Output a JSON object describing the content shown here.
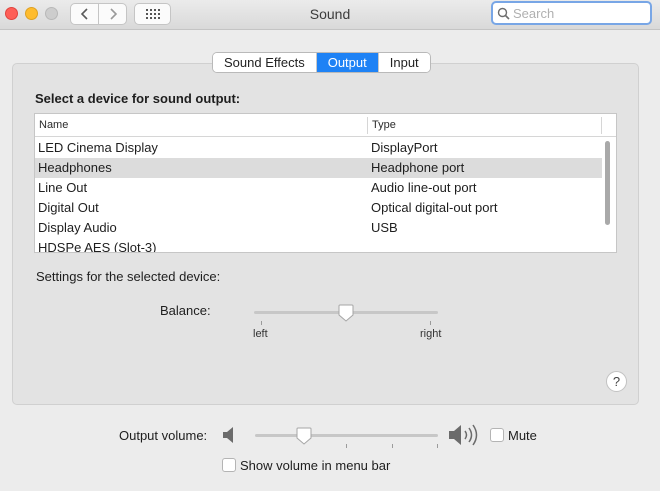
{
  "window": {
    "title": "Sound"
  },
  "search": {
    "placeholder": "Search"
  },
  "tabs": [
    {
      "label": "Sound Effects",
      "active": false
    },
    {
      "label": "Output",
      "active": true
    },
    {
      "label": "Input",
      "active": false
    }
  ],
  "device_section": {
    "title": "Select a device for sound output:",
    "columns": [
      "Name",
      "Type"
    ],
    "rows": [
      {
        "name": "LED Cinema Display",
        "type": "DisplayPort",
        "selected": false
      },
      {
        "name": "Headphones",
        "type": "Headphone port",
        "selected": true
      },
      {
        "name": "Line Out",
        "type": "Audio line-out port",
        "selected": false
      },
      {
        "name": "Digital Out",
        "type": "Optical digital-out port",
        "selected": false
      },
      {
        "name": "Display Audio",
        "type": "USB",
        "selected": false
      },
      {
        "name": "HDSPe AES (Slot-3)",
        "type": "",
        "selected": false
      }
    ]
  },
  "settings": {
    "label": "Settings for the selected device:",
    "balance_label": "Balance:",
    "balance_left": "left",
    "balance_right": "right",
    "balance_value": 0.5
  },
  "help": {
    "label": "?"
  },
  "output": {
    "volume_label": "Output volume:",
    "volume_value": 0.27,
    "mute_label": "Mute",
    "mute_checked": false,
    "show_in_menubar_label": "Show volume in menu bar",
    "show_in_menubar_checked": false
  },
  "colors": {
    "accent": "#1e82f5",
    "close": "#fe5f57",
    "minimize": "#febc2e",
    "selected_row": "#dcdcdc"
  },
  "icons": [
    "close-icon",
    "minimize-icon",
    "maximize-icon",
    "back-chevron-icon",
    "forward-chevron-icon",
    "grid-icon",
    "search-icon",
    "speaker-low-icon",
    "speaker-high-icon"
  ]
}
